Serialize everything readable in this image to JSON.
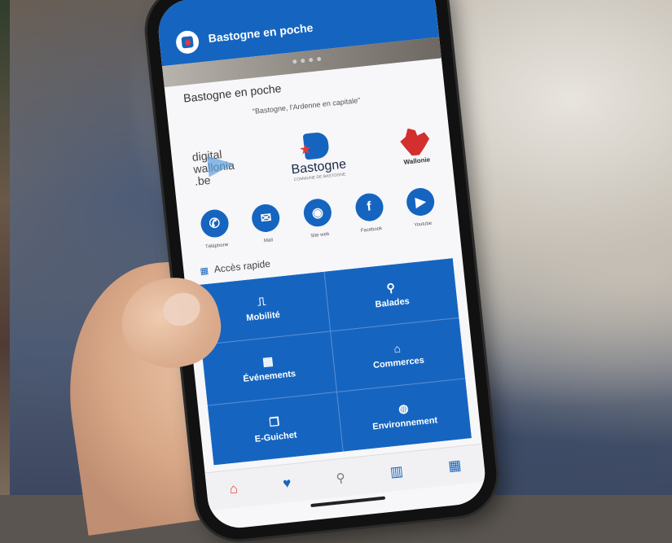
{
  "app": {
    "title": "Bastogne en poche"
  },
  "page": {
    "heading": "Bastogne en poche",
    "tagline": "\"Bastogne, l'Ardenne en capitale\""
  },
  "partners": {
    "digital_wallonia": [
      "digital",
      "wallonia",
      ".be"
    ],
    "bastogne": "Bastogne",
    "bastogne_sub": "COMMUNE DE BASTOGNE",
    "wallonie": "Wallonie"
  },
  "socials": [
    {
      "label": "Téléphone",
      "icon": "phone-icon",
      "glyph": "✆"
    },
    {
      "label": "Mail",
      "icon": "mail-icon",
      "glyph": "✉"
    },
    {
      "label": "Site web",
      "icon": "globe-icon",
      "glyph": "◉"
    },
    {
      "label": "Facebook",
      "icon": "facebook-icon",
      "glyph": "f"
    },
    {
      "label": "Youtube",
      "icon": "youtube-icon",
      "glyph": "▶"
    }
  ],
  "quick_access": {
    "label": "Accès rapide",
    "tiles": [
      {
        "label": "Mobilité",
        "icon": "bus-icon",
        "glyph": "⎍"
      },
      {
        "label": "Balades",
        "icon": "hiking-icon",
        "glyph": "⚲"
      },
      {
        "label": "Événements",
        "icon": "calendar-icon",
        "glyph": "▦"
      },
      {
        "label": "Commerces",
        "icon": "store-icon",
        "glyph": "⌂"
      },
      {
        "label": "E-Guichet",
        "icon": "documents-icon",
        "glyph": "❐"
      },
      {
        "label": "Environnement",
        "icon": "globe-icon",
        "glyph": "◍"
      }
    ]
  },
  "bottom_nav": [
    {
      "icon": "home-icon",
      "glyph": "⌂"
    },
    {
      "icon": "heart-icon",
      "glyph": "♥"
    },
    {
      "icon": "search-icon",
      "glyph": "⚲"
    },
    {
      "icon": "map-icon",
      "glyph": "▥"
    },
    {
      "icon": "grid-icon",
      "glyph": "▦"
    }
  ],
  "colors": {
    "primary": "#1565c0",
    "accent": "#e53935"
  }
}
